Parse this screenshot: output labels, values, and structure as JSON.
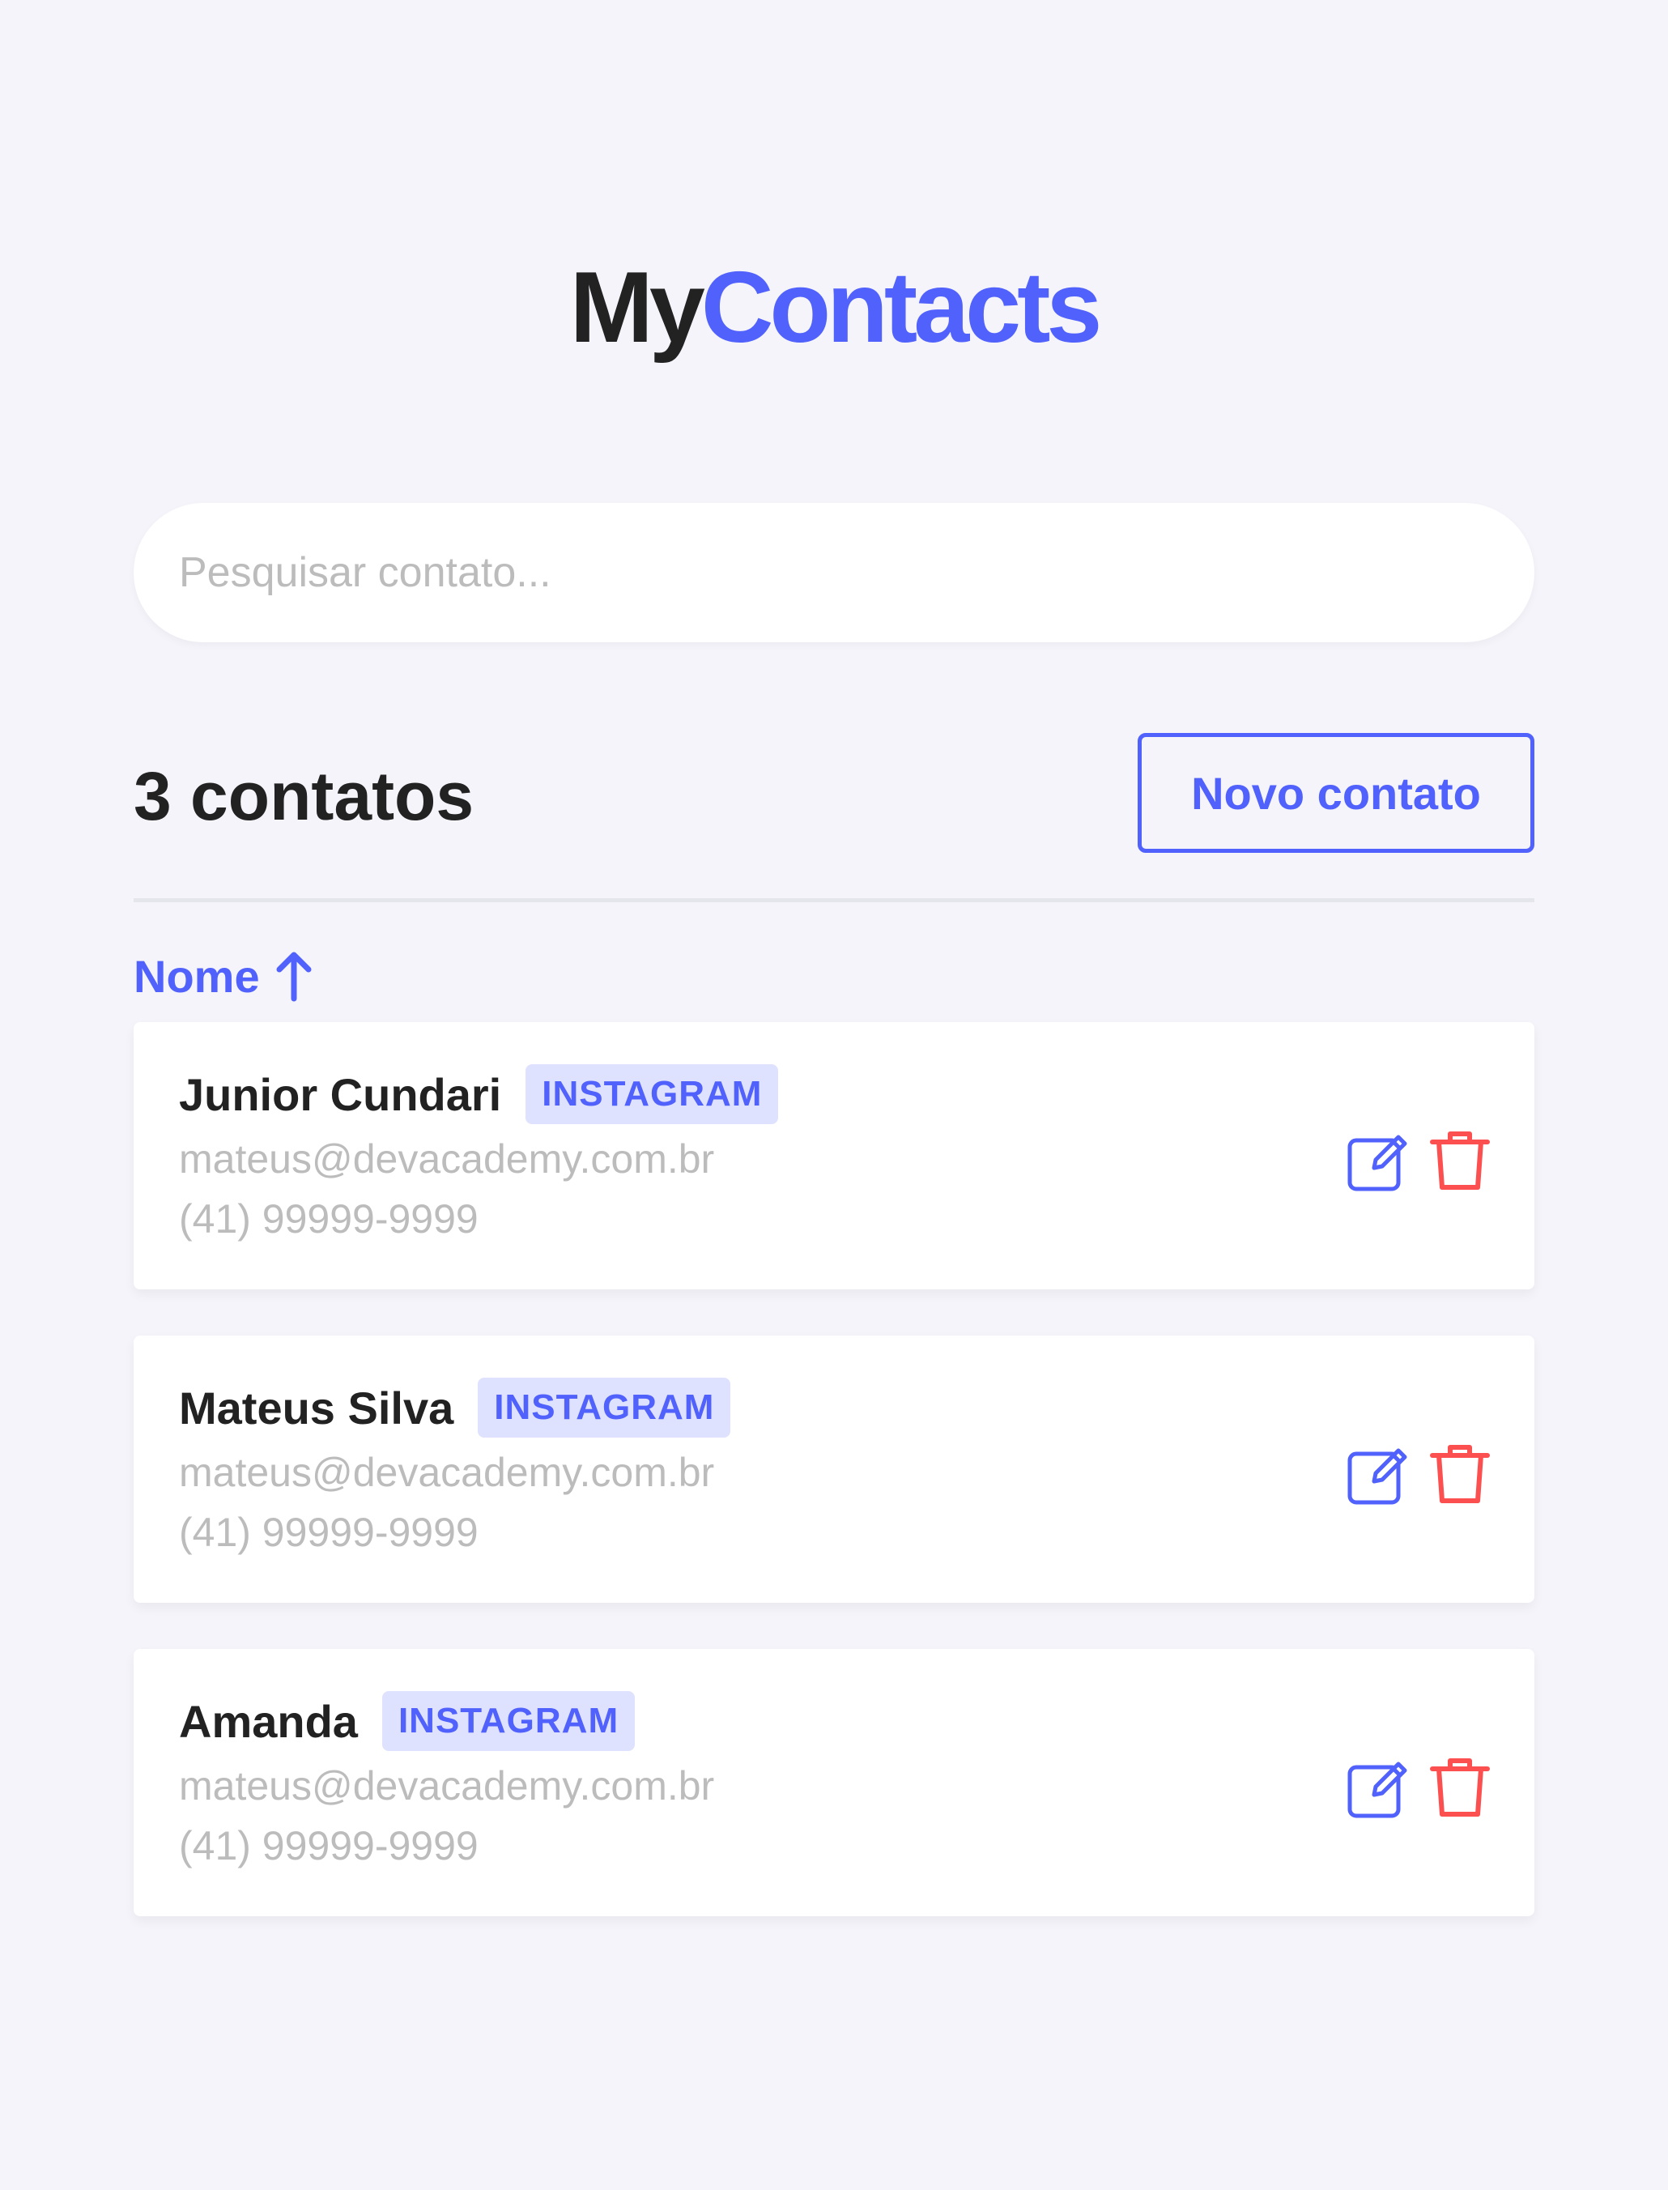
{
  "logo": {
    "part1": "My",
    "part2": "Contacts"
  },
  "search": {
    "placeholder": "Pesquisar contato..."
  },
  "header": {
    "count_label": "3 contatos",
    "new_contact_label": "Novo contato"
  },
  "sort": {
    "label": "Nome",
    "direction_icon": "arrow-up-icon"
  },
  "contacts": [
    {
      "name": "Junior Cundari",
      "category": "INSTAGRAM",
      "email": "mateus@devacademy.com.br",
      "phone": "(41) 99999-9999"
    },
    {
      "name": "Mateus Silva",
      "category": "INSTAGRAM",
      "email": "mateus@devacademy.com.br",
      "phone": "(41) 99999-9999"
    },
    {
      "name": "Amanda",
      "category": "INSTAGRAM",
      "email": "mateus@devacademy.com.br",
      "phone": "(41) 99999-9999"
    }
  ],
  "icons": {
    "edit": "edit-icon",
    "delete": "trash-icon"
  },
  "colors": {
    "primary": "#5061fc",
    "danger": "#fc5050",
    "tag_bg": "#dfe2fe",
    "background": "#f4f4fa",
    "muted_text": "#bcbcbc",
    "text": "#222222"
  }
}
